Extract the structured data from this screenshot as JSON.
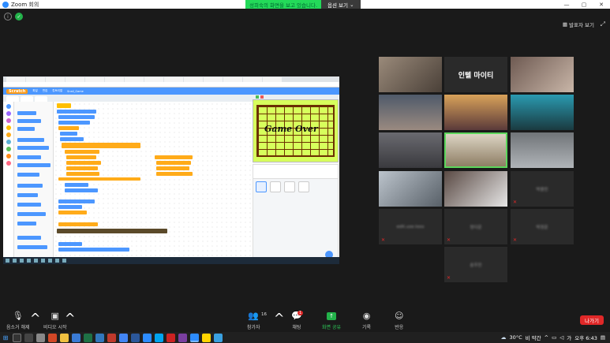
{
  "window": {
    "title": "Zoom 회의",
    "minimize": "—",
    "maximize": "▢",
    "close": "✕"
  },
  "share_banner": {
    "text": "성희숙의 화면을 보고 있습니다.",
    "options": "옵션 보기"
  },
  "top_right": {
    "speaker_view": "발표자 보기"
  },
  "shared_screen": {
    "app": "Scratch",
    "menu_items": [
      "파일",
      "편집",
      "튜토리얼",
      "Snail_Game"
    ],
    "stage_text": "Game Over"
  },
  "participants": [
    {
      "type": "video",
      "name": ""
    },
    {
      "type": "name",
      "name": "인텔 마이티"
    },
    {
      "type": "video",
      "name": ""
    },
    {
      "type": "video",
      "name": ""
    },
    {
      "type": "video",
      "name": ""
    },
    {
      "type": "video",
      "name": ""
    },
    {
      "type": "video",
      "name": ""
    },
    {
      "type": "video",
      "name": "",
      "active": true
    },
    {
      "type": "video",
      "name": ""
    },
    {
      "type": "video",
      "name": ""
    },
    {
      "type": "video",
      "name": ""
    },
    {
      "type": "blur",
      "name": "박종민"
    },
    {
      "type": "blur",
      "name": "edit.use.toss"
    },
    {
      "type": "blur",
      "name": "정다운"
    },
    {
      "type": "blur",
      "name": "박정운"
    },
    {
      "type": "blur",
      "name": "송우진"
    }
  ],
  "controls": {
    "audio": "음소거 해제",
    "video": "비디오 시작",
    "participants": "참가자",
    "participants_count": "16",
    "chat": "채팅",
    "chat_badge": "1",
    "share": "화면 공유",
    "record": "기록",
    "reactions": "반응",
    "leave": "나가기"
  },
  "tray": {
    "temperature": "30°C",
    "weather": "비 약간",
    "ime": "가",
    "time": "오후 6:43"
  },
  "colors": {
    "leave": "#e02828",
    "share_green": "#23b24a",
    "zoom_blue": "#2d8cff"
  }
}
